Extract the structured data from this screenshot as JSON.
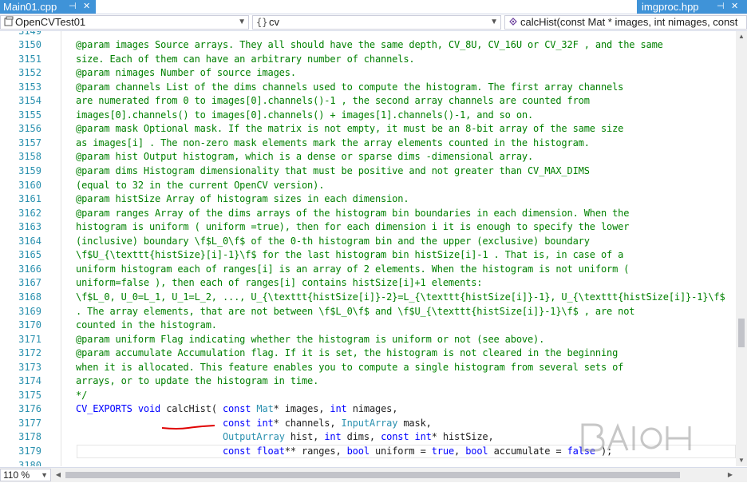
{
  "tabs": [
    {
      "label": "Main01.cpp",
      "active": true
    },
    {
      "label": "imgproc.hpp",
      "active": true
    }
  ],
  "navbar": {
    "project": "OpenCVTest01",
    "scope": "cv",
    "member": "calcHist(const Mat * images, int nimages, const"
  },
  "zoom": "110 %",
  "colors": {
    "tab_active": "#3f93d8",
    "comment": "#008000",
    "keyword": "#0000ff",
    "type": "#2b91af",
    "line_number": "#2b91af",
    "annotation_underline": "#e00000"
  },
  "icons": {
    "scope_icon": "braces-icon",
    "member_icon": "method-icon"
  },
  "editor": {
    "lines": [
      {
        "num": "3149",
        "tokens": [
          {
            "t": "comment",
            "v": ""
          }
        ]
      },
      {
        "num": "3150",
        "tokens": [
          {
            "t": "comment",
            "v": "@param images Source arrays. They all should have the same depth, CV_8U, CV_16U or CV_32F , and the same"
          }
        ]
      },
      {
        "num": "3151",
        "tokens": [
          {
            "t": "comment",
            "v": "size. Each of them can have an arbitrary number of channels."
          }
        ]
      },
      {
        "num": "3152",
        "tokens": [
          {
            "t": "comment",
            "v": "@param nimages Number of source images."
          }
        ]
      },
      {
        "num": "3153",
        "tokens": [
          {
            "t": "comment",
            "v": "@param channels List of the dims channels used to compute the histogram. The first array channels"
          }
        ]
      },
      {
        "num": "3154",
        "tokens": [
          {
            "t": "comment",
            "v": "are numerated from 0 to images[0].channels()-1 , the second array channels are counted from"
          }
        ]
      },
      {
        "num": "3155",
        "tokens": [
          {
            "t": "comment",
            "v": "images[0].channels() to images[0].channels() + images[1].channels()-1, and so on."
          }
        ]
      },
      {
        "num": "3156",
        "tokens": [
          {
            "t": "comment",
            "v": "@param mask Optional mask. If the matrix is not empty, it must be an 8-bit array of the same size"
          }
        ]
      },
      {
        "num": "3157",
        "tokens": [
          {
            "t": "comment",
            "v": "as images[i] . The non-zero mask elements mark the array elements counted in the histogram."
          }
        ]
      },
      {
        "num": "3158",
        "tokens": [
          {
            "t": "comment",
            "v": "@param hist Output histogram, which is a dense or sparse dims -dimensional array."
          }
        ]
      },
      {
        "num": "3159",
        "tokens": [
          {
            "t": "comment",
            "v": "@param dims Histogram dimensionality that must be positive and not greater than CV_MAX_DIMS"
          }
        ]
      },
      {
        "num": "3160",
        "tokens": [
          {
            "t": "comment",
            "v": "(equal to 32 in the current OpenCV version)."
          }
        ]
      },
      {
        "num": "3161",
        "tokens": [
          {
            "t": "comment",
            "v": "@param histSize Array of histogram sizes in each dimension."
          }
        ]
      },
      {
        "num": "3162",
        "tokens": [
          {
            "t": "comment",
            "v": "@param ranges Array of the dims arrays of the histogram bin boundaries in each dimension. When the"
          }
        ]
      },
      {
        "num": "3163",
        "tokens": [
          {
            "t": "comment",
            "v": "histogram is uniform ( uniform =true), then for each dimension i it is enough to specify the lower"
          }
        ]
      },
      {
        "num": "3164",
        "tokens": [
          {
            "t": "comment",
            "v": "(inclusive) boundary \\f$L_0\\f$ of the 0-th histogram bin and the upper (exclusive) boundary"
          }
        ]
      },
      {
        "num": "3165",
        "tokens": [
          {
            "t": "comment",
            "v": "\\f$U_{\\texttt{histSize}[i]-1}\\f$ for the last histogram bin histSize[i]-1 . That is, in case of a"
          }
        ]
      },
      {
        "num": "3166",
        "tokens": [
          {
            "t": "comment",
            "v": "uniform histogram each of ranges[i] is an array of 2 elements. When the histogram is not uniform ("
          }
        ]
      },
      {
        "num": "3167",
        "tokens": [
          {
            "t": "comment",
            "v": "uniform=false ), then each of ranges[i] contains histSize[i]+1 elements:"
          }
        ]
      },
      {
        "num": "3168",
        "tokens": [
          {
            "t": "comment",
            "v": "\\f$L_0, U_0=L_1, U_1=L_2, ..., U_{\\texttt{histSize[i]}-2}=L_{\\texttt{histSize[i]}-1}, U_{\\texttt{histSize[i]}-1}\\f$"
          }
        ]
      },
      {
        "num": "3169",
        "tokens": [
          {
            "t": "comment",
            "v": ". The array elements, that are not between \\f$L_0\\f$ and \\f$U_{\\texttt{histSize[i]}-1}\\f$ , are not"
          }
        ]
      },
      {
        "num": "3170",
        "tokens": [
          {
            "t": "comment",
            "v": "counted in the histogram."
          }
        ]
      },
      {
        "num": "3171",
        "tokens": [
          {
            "t": "comment",
            "v": "@param uniform Flag indicating whether the histogram is uniform or not (see above)."
          }
        ]
      },
      {
        "num": "3172",
        "tokens": [
          {
            "t": "comment",
            "v": "@param accumulate Accumulation flag. If it is set, the histogram is not cleared in the beginning"
          }
        ]
      },
      {
        "num": "3173",
        "tokens": [
          {
            "t": "comment",
            "v": "when it is allocated. This feature enables you to compute a single histogram from several sets of"
          }
        ]
      },
      {
        "num": "3174",
        "tokens": [
          {
            "t": "comment",
            "v": "arrays, or to update the histogram in time."
          }
        ]
      },
      {
        "num": "3175",
        "tokens": [
          {
            "t": "comment",
            "v": "*/"
          }
        ]
      },
      {
        "num": "3176",
        "tokens": [
          {
            "t": "kw",
            "v": "CV_EXPORTS void "
          },
          {
            "t": "func",
            "v": "calcHist"
          },
          {
            "t": "plain",
            "v": "( "
          },
          {
            "t": "kw",
            "v": "const "
          },
          {
            "t": "type",
            "v": "Mat"
          },
          {
            "t": "plain",
            "v": "* images, "
          },
          {
            "t": "kw",
            "v": "int "
          },
          {
            "t": "plain",
            "v": "nimages,"
          }
        ]
      },
      {
        "num": "3177",
        "tokens": [
          {
            "t": "plain",
            "v": "                          "
          },
          {
            "t": "kw",
            "v": "const int"
          },
          {
            "t": "plain",
            "v": "* channels, "
          },
          {
            "t": "type",
            "v": "InputArray"
          },
          {
            "t": "plain",
            "v": " mask,"
          }
        ]
      },
      {
        "num": "3178",
        "tokens": [
          {
            "t": "plain",
            "v": "                          "
          },
          {
            "t": "type",
            "v": "OutputArray"
          },
          {
            "t": "plain",
            "v": " hist, "
          },
          {
            "t": "kw",
            "v": "int "
          },
          {
            "t": "plain",
            "v": "dims, "
          },
          {
            "t": "kw",
            "v": "const int"
          },
          {
            "t": "plain",
            "v": "* histSize,"
          }
        ]
      },
      {
        "num": "3179",
        "tokens": [
          {
            "t": "plain",
            "v": "                          "
          },
          {
            "t": "kw",
            "v": "const float"
          },
          {
            "t": "plain",
            "v": "** ranges, "
          },
          {
            "t": "kw",
            "v": "bool "
          },
          {
            "t": "plain",
            "v": "uniform = "
          },
          {
            "t": "kw",
            "v": "true"
          },
          {
            "t": "plain",
            "v": ", "
          },
          {
            "t": "kw",
            "v": "bool"
          },
          {
            "t": "plain",
            "v": " accumulate = "
          },
          {
            "t": "kw",
            "v": "false"
          },
          {
            "t": "plain",
            "v": " );"
          }
        ]
      },
      {
        "num": "3180",
        "tokens": [
          {
            "t": "plain",
            "v": ""
          }
        ]
      }
    ]
  }
}
